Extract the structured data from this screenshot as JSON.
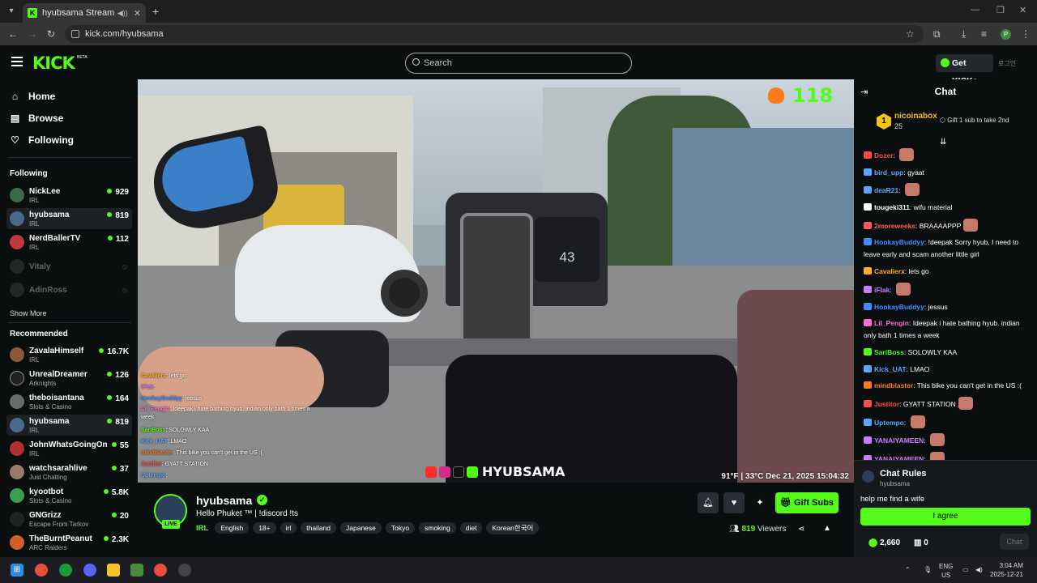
{
  "browser": {
    "tab_title": "hyubsama Stream - Watch",
    "url": "kick.com/hyubsama"
  },
  "header": {
    "logo": "KICK",
    "beta": "BETA",
    "search_placeholder": "Search",
    "get_kicks": "Get KICKs",
    "login": "로그인"
  },
  "sidebar": {
    "nav": [
      {
        "label": "Home",
        "icon": "home-icon"
      },
      {
        "label": "Browse",
        "icon": "browse-icon"
      },
      {
        "label": "Following",
        "icon": "heart-icon"
      }
    ],
    "following_title": "Following",
    "following": [
      {
        "name": "NickLee",
        "category": "IRL",
        "viewers": "929"
      },
      {
        "name": "hyubsama",
        "category": "IRL",
        "viewers": "819"
      },
      {
        "name": "NerdBallerTV",
        "category": "IRL",
        "viewers": "112"
      },
      {
        "name": "Vitaly",
        "category": "",
        "viewers": ""
      },
      {
        "name": "AdinRoss",
        "category": "",
        "viewers": ""
      }
    ],
    "show_more": "Show More",
    "recommended_title": "Recommended",
    "recommended": [
      {
        "name": "ZavalaHimself",
        "category": "IRL",
        "viewers": "16.7K"
      },
      {
        "name": "UnrealDreamer",
        "category": "Arknights",
        "viewers": "126"
      },
      {
        "name": "theboisantana",
        "category": "Slots & Casino",
        "viewers": "164"
      },
      {
        "name": "hyubsama",
        "category": "IRL",
        "viewers": "819"
      },
      {
        "name": "JohnWhatsGoingOn",
        "category": "IRL",
        "viewers": "55"
      },
      {
        "name": "watchsarahlive",
        "category": "Just Chatting",
        "viewers": "37"
      },
      {
        "name": "kyootbot",
        "category": "Slots & Casino",
        "viewers": "5.8K"
      },
      {
        "name": "GNGrizz",
        "category": "Escape From Tarkov",
        "viewers": "20"
      },
      {
        "name": "TheBurntPeanut",
        "category": "ARC Raiders",
        "viewers": "2.3K"
      }
    ]
  },
  "video": {
    "kills": "118",
    "speed": "43",
    "handle": "HYUBSAMA",
    "status": "91°F | 33°C   Dec 21, 2025   15:04:32",
    "overlay_chat": [
      {
        "user": "Cavalierx",
        "text": "lets go"
      },
      {
        "user": "iFlak",
        "text": ""
      },
      {
        "user": "HookayBuddyy",
        "text": "jeesus"
      },
      {
        "user": "Lil_Pengin",
        "text": "Ideepak i hate bathing hyub. indian only bath 1 times a week"
      },
      {
        "user": "SariBoss",
        "text": "SOLOWLY KAA"
      },
      {
        "user": "Kick_UAT",
        "text": "LMAO"
      },
      {
        "user": "mindblaster",
        "text": "This bike you can't get in the US :("
      },
      {
        "user": "Justitor",
        "text": "GYATT STATION"
      },
      {
        "user": "Uptempo",
        "text": ""
      }
    ]
  },
  "channel": {
    "name": "hyubsama",
    "live": "LIVE",
    "title": "Hello Phuket ™ | !discord !ts",
    "category": "IRL",
    "tags": [
      "English",
      "18+",
      "irl",
      "thailand",
      "Japanese",
      "Tokyo",
      "smoking",
      "diet",
      "Korean한국어"
    ],
    "gift_subs": "Gift Subs",
    "viewers": "819",
    "viewers_label": "Viewers"
  },
  "chat": {
    "title": "Chat",
    "pinned": {
      "rank": "1",
      "name": "nicoinabox",
      "count": "25",
      "gift_text": "Gift 1 sub to take 2nd"
    },
    "messages": [
      {
        "user": "Dozer",
        "text": "",
        "color": "#ff4a4a",
        "emote": true
      },
      {
        "user": "bird_upp",
        "text": "gyaat",
        "color": "#5aa7ff",
        "emote": false
      },
      {
        "user": "deaR21",
        "text": "",
        "color": "#5aa7ff",
        "emote": true
      },
      {
        "user": "tougeki311",
        "text": "wifu material",
        "color": "#ffffff",
        "emote": false
      },
      {
        "user": "2moreweeks",
        "text": "BRAAAAPPP",
        "color": "#ff5a5a",
        "emote": true
      },
      {
        "user": "HookayBuddyy",
        "text": "!deepak Sorry hyub, I need to leave early and scam another little girl",
        "color": "#3f8cff",
        "emote": false
      },
      {
        "user": "Cavalierx",
        "text": "lets go",
        "color": "#ffb020",
        "emote": false
      },
      {
        "user": "iFlak",
        "text": "",
        "color": "#c77dff",
        "emote": true
      },
      {
        "user": "HookayBuddyy",
        "text": "jessus",
        "color": "#3f8cff",
        "emote": false
      },
      {
        "user": "Lil_Pengin",
        "text": "Ideepak i hate bathing hyub. indian only bath 1 times a week",
        "color": "#ff6ad5",
        "emote": false
      },
      {
        "user": "SariBoss",
        "text": "SOLOWLY KAA",
        "color": "#53fc18",
        "emote": false
      },
      {
        "user": "Kick_UAT",
        "text": "LMAO",
        "color": "#5aa7ff",
        "emote": false
      },
      {
        "user": "mindblaster",
        "text": "This bike you can't get in the US :(",
        "color": "#ff7a1a",
        "emote": false
      },
      {
        "user": "Justitor",
        "text": "GYATT STATION",
        "color": "#ff4a4a",
        "emote": true
      },
      {
        "user": "Uptempo",
        "text": "",
        "color": "#5aa7ff",
        "emote": true
      },
      {
        "user": "YANAIYAMEEN",
        "text": "",
        "color": "#c77dff",
        "emote": true
      },
      {
        "user": "YANAIYAMEEN",
        "text": "",
        "color": "#c77dff",
        "emote": true
      }
    ],
    "rules_title": "Chat Rules",
    "rules_sub": "hyubsama",
    "rules_text": "help me find a wife",
    "agree": "I agree",
    "balance": "2,660",
    "subs": "0",
    "chat_button": "Chat"
  },
  "taskbar": {
    "lang": "ENG",
    "region": "US",
    "time": "3:04 AM",
    "date": "2025-12-21"
  }
}
